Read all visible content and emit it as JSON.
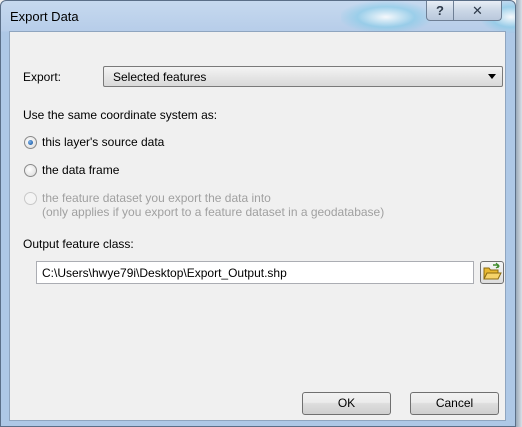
{
  "window": {
    "title": "Export Data"
  },
  "title_buttons": {
    "help_glyph": "?",
    "close_glyph": "✕"
  },
  "export": {
    "label": "Export:",
    "selected": "Selected features"
  },
  "coordinate": {
    "heading": "Use the same coordinate system as:",
    "options": [
      {
        "label": "this layer's source data",
        "checked": true,
        "enabled": true
      },
      {
        "label": "the data frame",
        "checked": false,
        "enabled": true
      },
      {
        "label": "the feature dataset you export the data into",
        "sublabel": "(only applies if you export to a feature dataset in a geodatabase)",
        "checked": false,
        "enabled": false
      }
    ]
  },
  "output": {
    "label": "Output feature class:",
    "value": "C:\\Users\\hwye79i\\Desktop\\Export_Output.shp"
  },
  "buttons": {
    "ok": "OK",
    "cancel": "Cancel"
  },
  "icons": {
    "help": "help-icon",
    "close": "close-icon",
    "dropdown": "chevron-down-icon",
    "folder": "open-folder-icon"
  },
  "colors": {
    "title_bar": "#b7cde9",
    "dialog_bg": "#f0f0f0",
    "radio_dot": "#1f5fa8",
    "folder_icon": "#e8b830"
  }
}
